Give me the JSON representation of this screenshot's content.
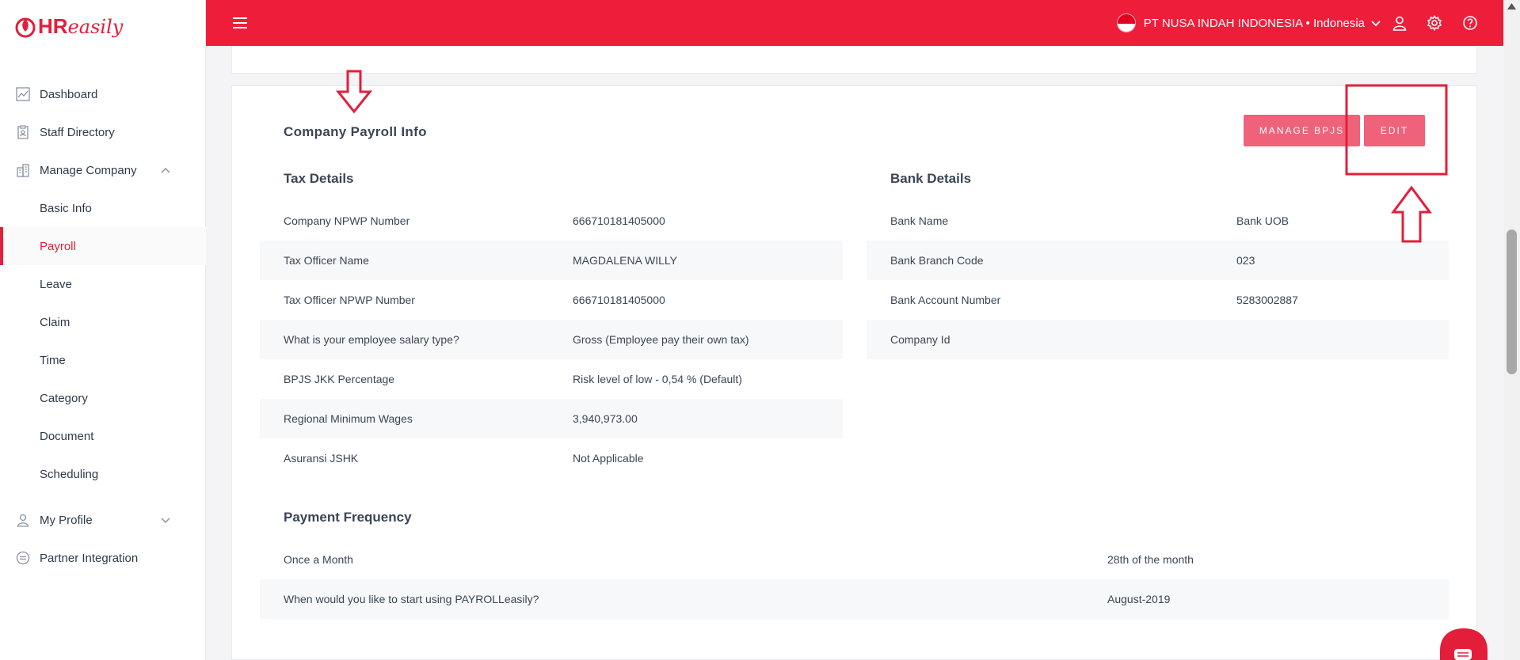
{
  "brand": {
    "hr": "HR",
    "easily": "easily"
  },
  "sidebar": {
    "items": [
      {
        "label": "Dashboard"
      },
      {
        "label": "Staff Directory"
      },
      {
        "label": "Manage Company"
      },
      {
        "label": "Basic Info"
      },
      {
        "label": "Payroll"
      },
      {
        "label": "Leave"
      },
      {
        "label": "Claim"
      },
      {
        "label": "Time"
      },
      {
        "label": "Category"
      },
      {
        "label": "Document"
      },
      {
        "label": "Scheduling"
      },
      {
        "label": "My Profile"
      },
      {
        "label": "Partner Integration"
      }
    ],
    "active": "Payroll"
  },
  "topbar": {
    "company": "PT NUSA INDAH INDONESIA • Indonesia",
    "color": "#ee1e3a"
  },
  "card": {
    "title": "Company Payroll Info",
    "manage_bpjs": "MANAGE BPJS",
    "edit": "EDIT"
  },
  "tax": {
    "title": "Tax Details",
    "rows": [
      {
        "label": "Company NPWP Number",
        "value": "666710181405000"
      },
      {
        "label": "Tax Officer Name",
        "value": "MAGDALENA WILLY"
      },
      {
        "label": "Tax Officer NPWP Number",
        "value": "666710181405000"
      },
      {
        "label": "What is your employee salary type?",
        "value": "Gross (Employee pay their own tax)"
      },
      {
        "label": "BPJS JKK Percentage",
        "value": "Risk level of low - 0,54 % (Default)"
      },
      {
        "label": "Regional Minimum Wages",
        "value": "3,940,973.00"
      },
      {
        "label": "Asuransi JSHK",
        "value": "Not Applicable"
      }
    ]
  },
  "bank": {
    "title": "Bank Details",
    "rows": [
      {
        "label": "Bank Name",
        "value": "Bank UOB"
      },
      {
        "label": "Bank Branch Code",
        "value": "023"
      },
      {
        "label": "Bank Account Number",
        "value": "5283002887"
      },
      {
        "label": "Company Id",
        "value": ""
      }
    ]
  },
  "payment": {
    "title": "Payment Frequency",
    "rows": [
      {
        "label": "Once a Month",
        "value": "28th of the month"
      },
      {
        "label": "When would you like to start using PAYROLLeasily?",
        "value": "August-2019"
      }
    ]
  },
  "colors": {
    "accent": "#ee1e3a",
    "button": "#f0617a",
    "annotation": "#e31e3a"
  }
}
